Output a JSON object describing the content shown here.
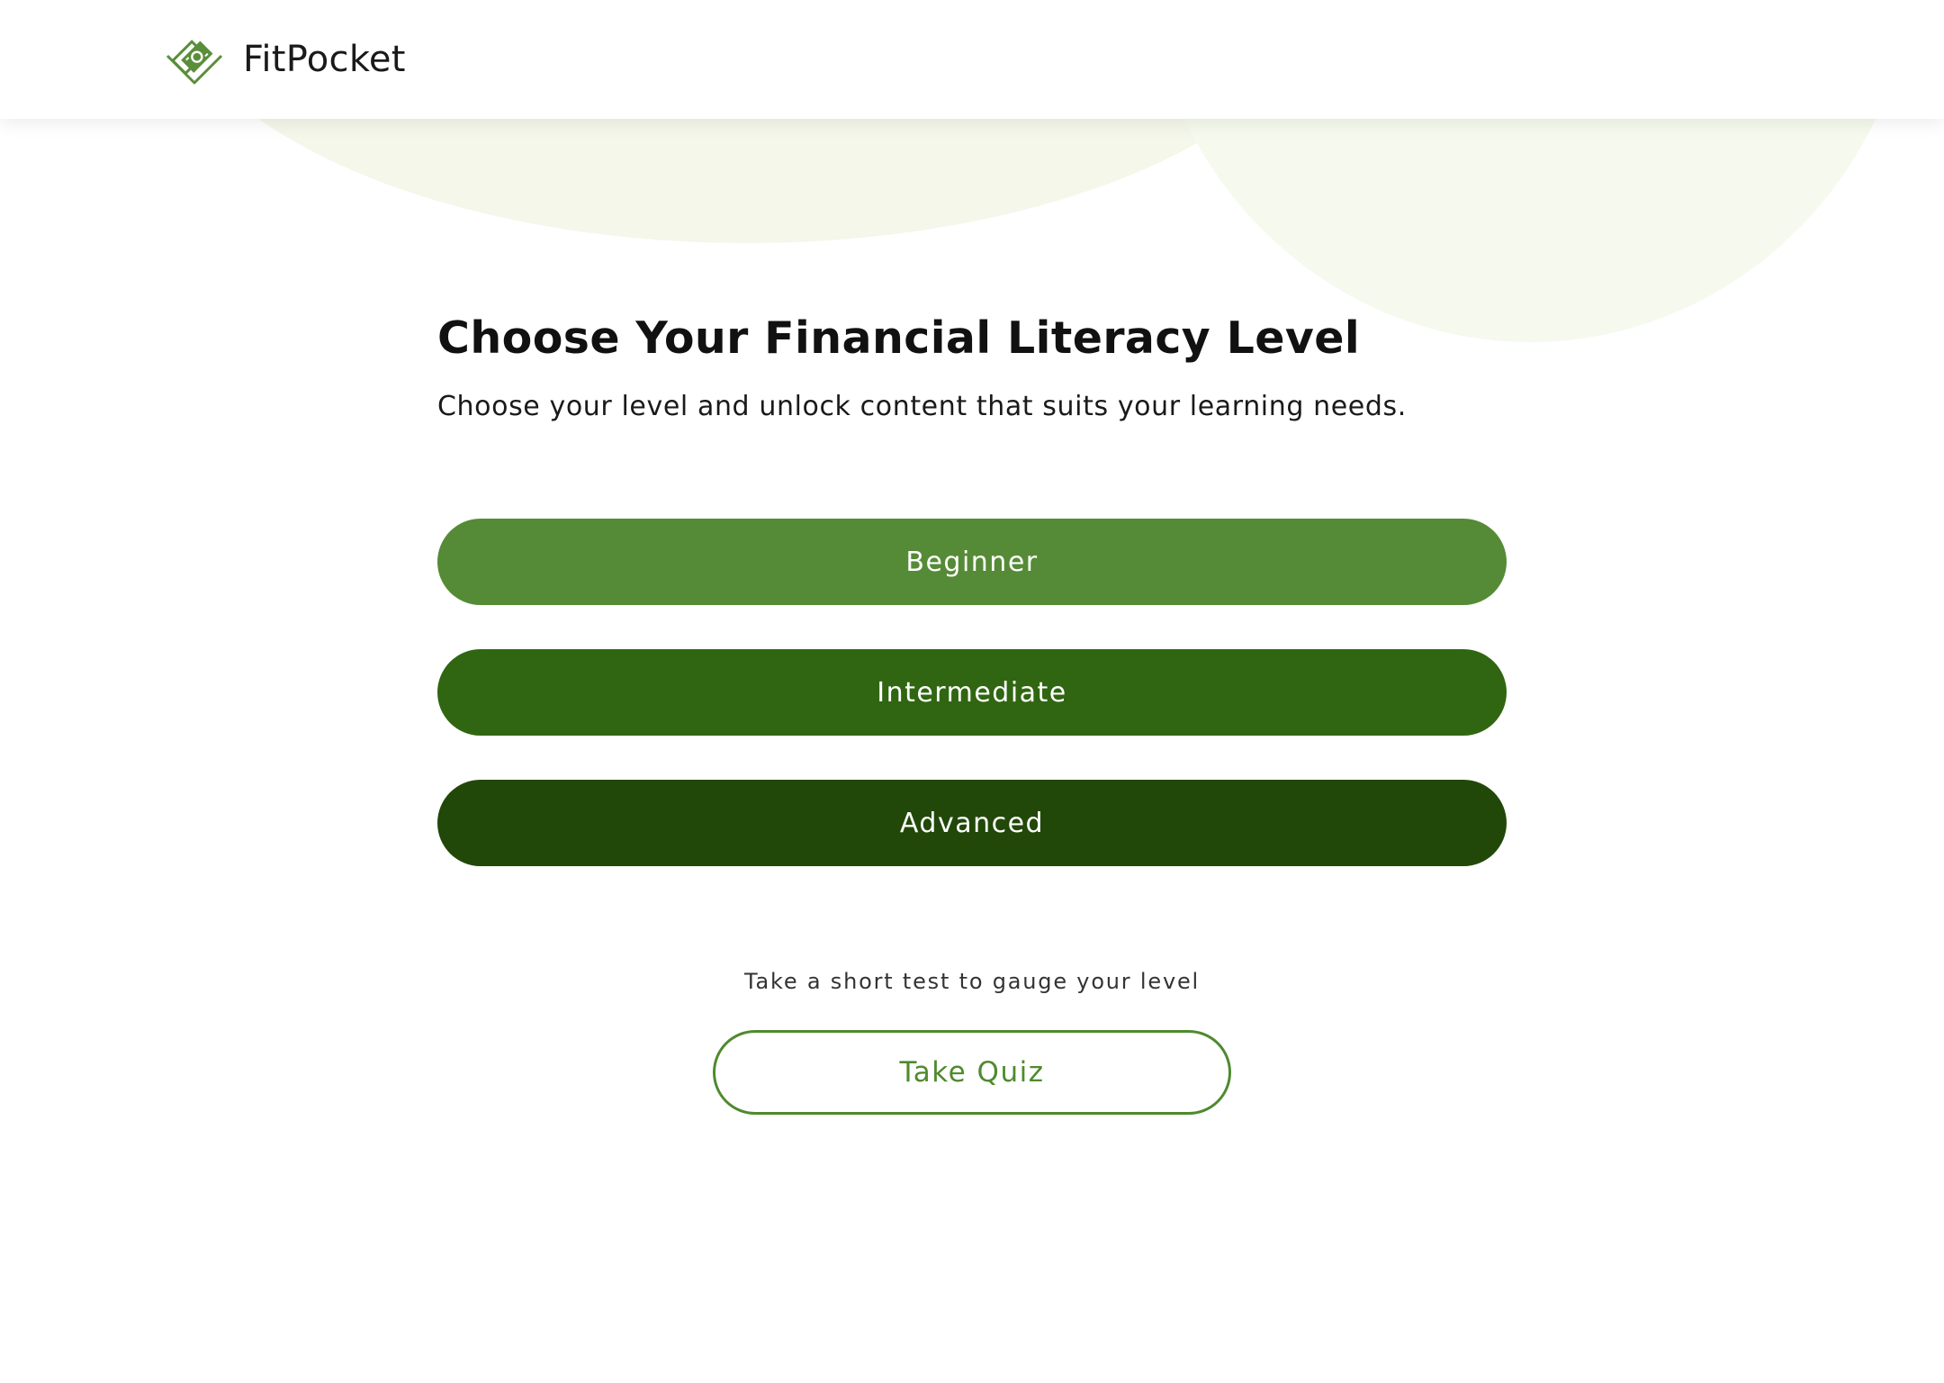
{
  "header": {
    "logo_icon": "money-heart-icon",
    "brand": "FitPocket"
  },
  "main": {
    "title": "Choose Your Financial Literacy Level",
    "subtitle": "Choose your level and unlock content that suits your learning needs.",
    "levels": [
      {
        "label": "Beginner",
        "color": "#558b36"
      },
      {
        "label": "Intermediate",
        "color": "#306611"
      },
      {
        "label": "Advanced",
        "color": "#224809"
      }
    ],
    "quiz": {
      "prompt": "Take a short test to gauge your level",
      "button_label": "Take Quiz",
      "accent": "#4f8a2e"
    }
  },
  "colors": {
    "background_blob_1": "#f4f7e9",
    "background_blob_2": "#f6f9ee",
    "text": "#111111"
  }
}
